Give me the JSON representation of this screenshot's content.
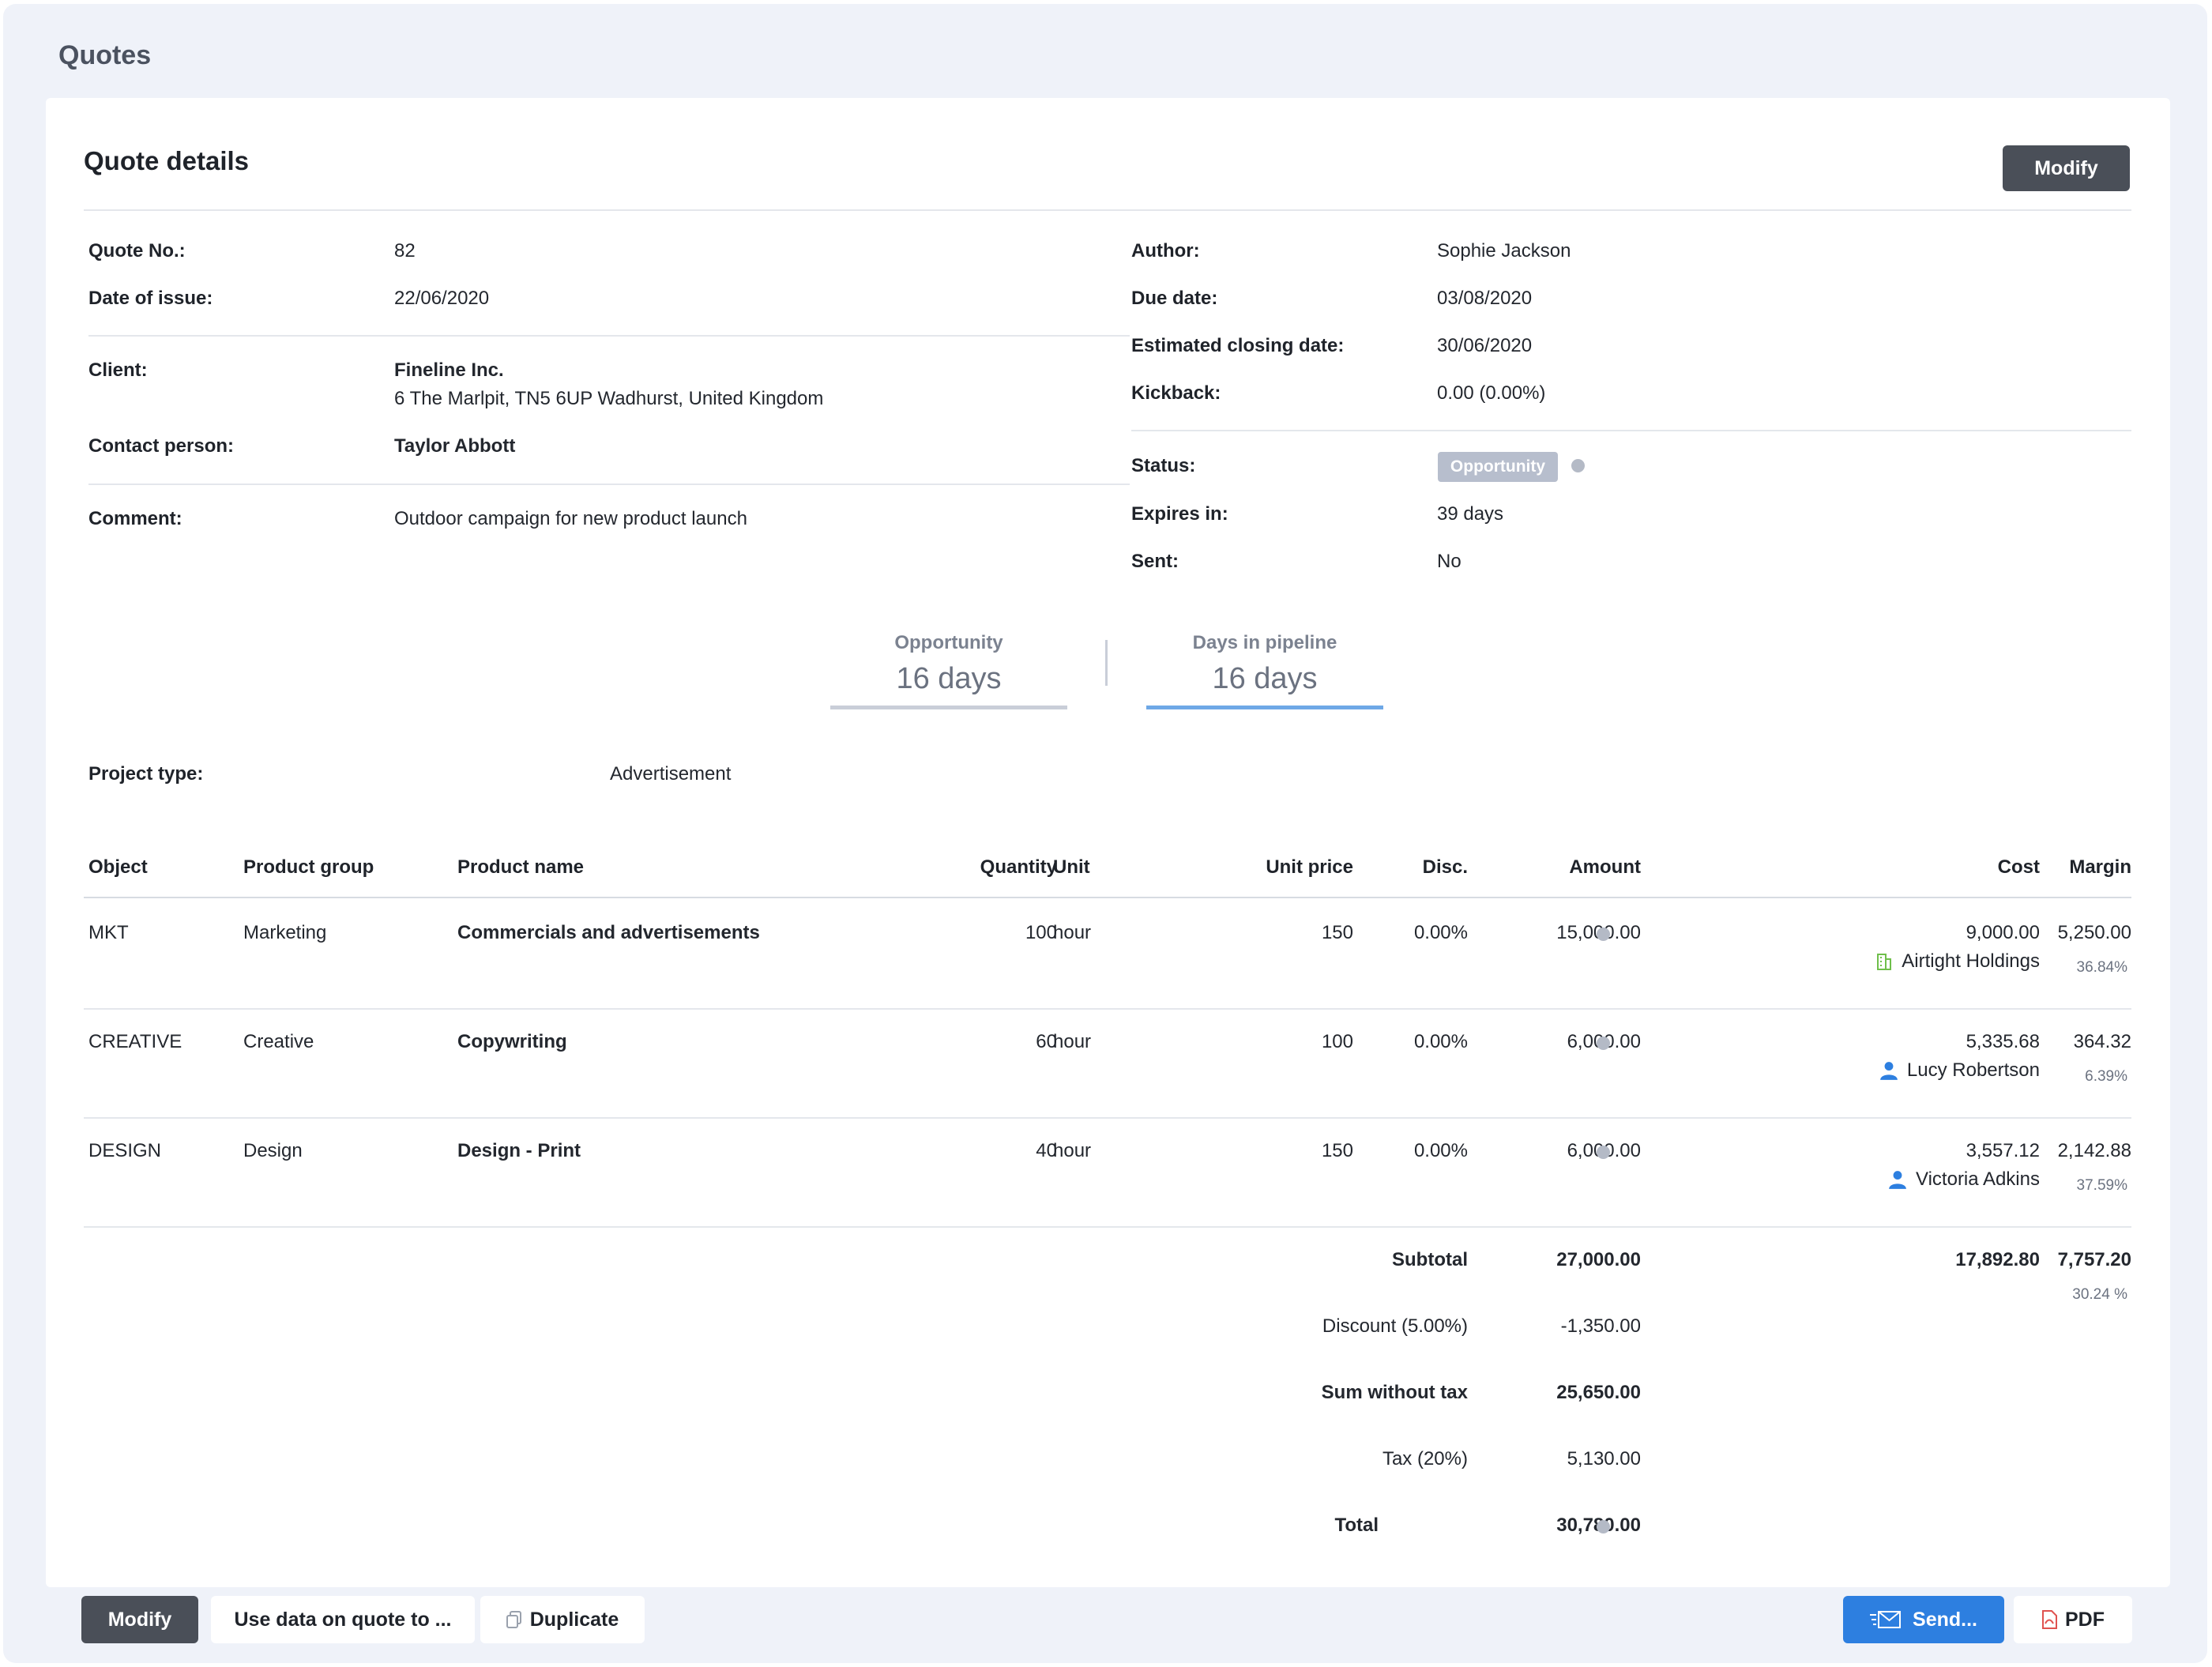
{
  "page": {
    "title": "Quotes"
  },
  "card": {
    "title": "Quote details",
    "modify_label": "Modify"
  },
  "details_left": [
    {
      "label": "Quote No.:",
      "value": "82"
    },
    {
      "label": "Date of issue:",
      "value": "22/06/2020"
    },
    {
      "label": "Client:",
      "value": "Fineline Inc.",
      "value2": "6 The Marlpit, TN5 6UP Wadhurst, United Kingdom"
    },
    {
      "label": "Contact person:",
      "value": "Taylor Abbott"
    },
    {
      "label": "Comment:",
      "value": "Outdoor campaign for new product launch"
    }
  ],
  "details_right": [
    {
      "label": "Author:",
      "value": "Sophie Jackson"
    },
    {
      "label": "Due date:",
      "value": "03/08/2020"
    },
    {
      "label": "Estimated closing date:",
      "value": "30/06/2020"
    },
    {
      "label": "Kickback:",
      "value": "0.00 (0.00%)"
    },
    {
      "label": "Status:",
      "value": "Opportunity"
    },
    {
      "label": "Expires in:",
      "value": "39 days"
    },
    {
      "label": "Sent:",
      "value": "No"
    }
  ],
  "pipeline": [
    {
      "label": "Opportunity",
      "value": "16 days",
      "bar_color": "#c9ced8"
    },
    {
      "label": "Days in pipeline",
      "value": "16 days",
      "bar_color": "#6ea8e6"
    }
  ],
  "project": {
    "label": "Project type:",
    "value": "Advertisement"
  },
  "table": {
    "headers": [
      "Object",
      "Product group",
      "Product name",
      "Quantity",
      "Unit",
      "Unit price",
      "Disc.",
      "Amount",
      "Cost",
      "Margin"
    ],
    "rows": [
      {
        "object": "MKT",
        "group": "Marketing",
        "name": "Commercials and advertisements",
        "quantity": "100",
        "unit": "hour",
        "unit_price": "150",
        "disc": "0.00%",
        "amount": "15,000.00",
        "cost": "9,000.00",
        "supplier": "Airtight Holdings",
        "supplier_icon": "building-icon",
        "margin": "5,250.00",
        "margin_pct": "36.84%"
      },
      {
        "object": "CREATIVE",
        "group": "Creative",
        "name": "Copywriting",
        "quantity": "60",
        "unit": "hour",
        "unit_price": "100",
        "disc": "0.00%",
        "amount": "6,000.00",
        "cost": "5,335.68",
        "supplier": "Lucy Robertson",
        "supplier_icon": "person-icon",
        "margin": "364.32",
        "margin_pct": "6.39%"
      },
      {
        "object": "DESIGN",
        "group": "Design",
        "name": "Design - Print",
        "quantity": "40",
        "unit": "hour",
        "unit_price": "150",
        "disc": "0.00%",
        "amount": "6,000.00",
        "cost": "3,557.12",
        "supplier": "Victoria Adkins",
        "supplier_icon": "person-icon",
        "margin": "2,142.88",
        "margin_pct": "37.59%"
      }
    ]
  },
  "totals": {
    "subtotal_label": "Subtotal",
    "subtotal": "27,000.00",
    "subtotal_cost": "17,892.80",
    "subtotal_margin": "7,757.20",
    "subtotal_margin_pct": "30.24 %",
    "discount_label": "Discount (5.00%)",
    "discount": "-1,350.00",
    "sum_label": "Sum without tax",
    "sum": "25,650.00",
    "tax_label": "Tax (20%)",
    "tax": "5,130.00",
    "total_label": "Total",
    "total": "30,780.00"
  },
  "actions": {
    "modify": "Modify",
    "use_data": "Use data on quote to ...",
    "duplicate": "Duplicate",
    "send": "Send...",
    "pdf": "PDF"
  },
  "colors": {
    "accent": "#2d7fe0",
    "dark_button": "#4a4f58",
    "badge": "#b7becd",
    "background": "#eff2f9"
  }
}
